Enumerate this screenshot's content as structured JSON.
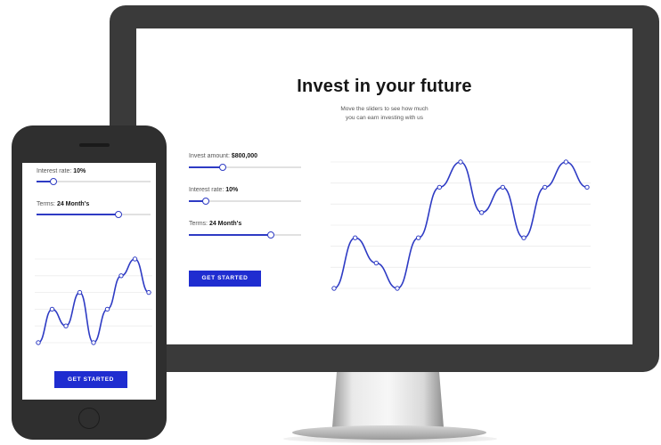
{
  "desktop": {
    "title": "Invest in your future",
    "subtitle_line1": "Move the sliders to see how much",
    "subtitle_line2": "you can earn investing with us",
    "controls": {
      "invest_label": "Invest amount:",
      "invest_value": "$800,000",
      "invest_fraction": 0.3,
      "rate_label": "Interest rate:",
      "rate_value": "10%",
      "rate_fraction": 0.15,
      "terms_label": "Terms:",
      "terms_value": "24 Month's",
      "terms_fraction": 0.73
    },
    "cta_label": "GET STARTED",
    "chart_data": {
      "type": "line",
      "y_tick_labels": [
        "",
        "",
        "",
        "",
        "",
        "",
        ""
      ],
      "values": [
        0,
        2,
        1,
        0,
        2,
        4,
        5,
        3,
        4,
        2,
        4,
        5,
        4
      ],
      "grid": true,
      "legend": "none",
      "color": "#2e3bc4"
    }
  },
  "mobile": {
    "rate_label": "Interest rate:",
    "rate_value": "10%",
    "rate_fraction": 0.15,
    "terms_label": "Terms:",
    "terms_value": "24 Month's",
    "terms_fraction": 0.72,
    "cta_label": "GET STARTED",
    "chart_data": {
      "type": "line",
      "values": [
        0,
        2,
        1,
        3,
        0,
        2,
        4,
        5,
        3
      ],
      "grid": true,
      "legend": "none",
      "color": "#2e3bc4"
    }
  },
  "colors": {
    "accent": "#1f2dd0",
    "device_frame": "#333333",
    "line": "#2e3bc4"
  }
}
